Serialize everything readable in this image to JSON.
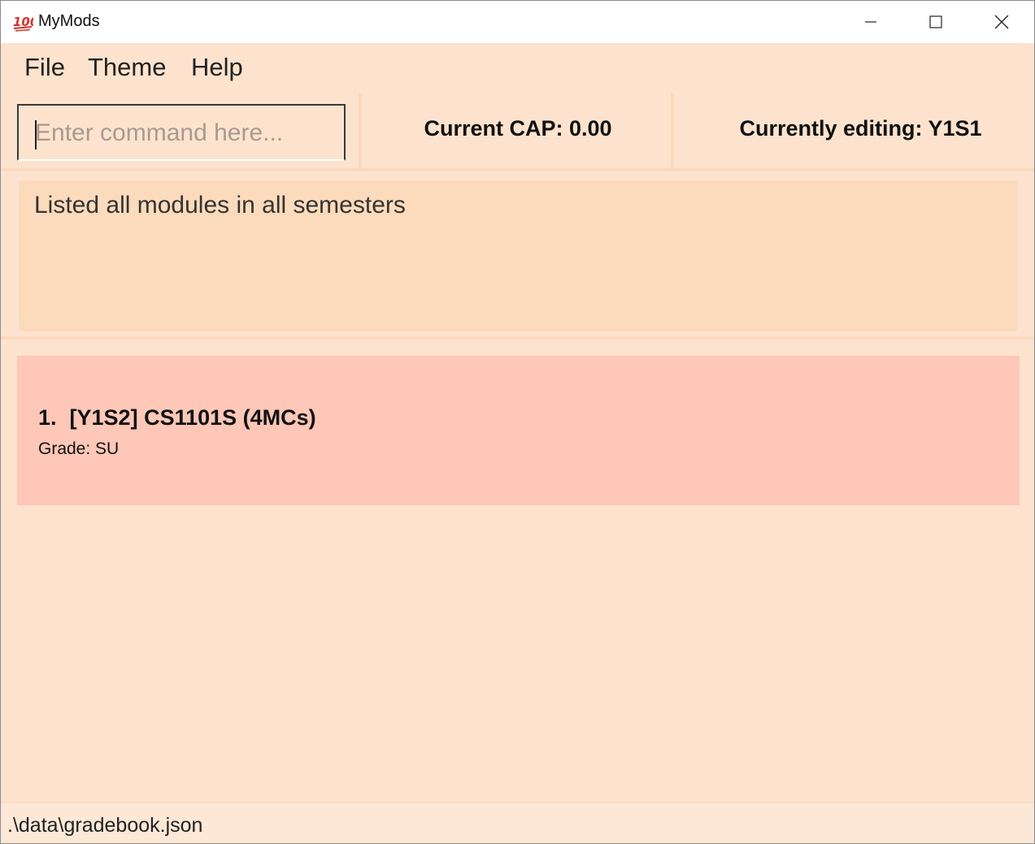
{
  "window": {
    "title": "MyMods",
    "icon": "hundred-points-emoji-icon"
  },
  "menu": {
    "file": "File",
    "theme": "Theme",
    "help": "Help"
  },
  "command": {
    "value": "",
    "placeholder": "Enter command here..."
  },
  "info": {
    "cap": "Current CAP: 0.00",
    "editing": "Currently editing: Y1S1"
  },
  "result": {
    "message": "Listed all modules in all semesters"
  },
  "modules": [
    {
      "index": "1.",
      "title": "[Y1S2] CS1101S (4MCs)",
      "grade": "Grade: SU"
    }
  ],
  "status": {
    "path": ".\\data\\gradebook.json"
  },
  "colors": {
    "background": "#fde3cd",
    "result_panel": "#fcdbbc",
    "module_card": "#fec7b8",
    "status_bar": "#fde8d7"
  }
}
